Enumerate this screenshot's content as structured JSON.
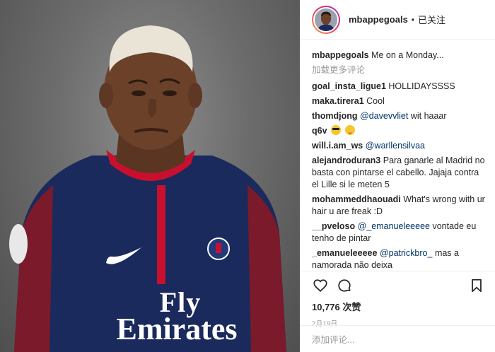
{
  "header": {
    "username": "mbappegoals",
    "separator": "•",
    "follow_status": "已关注"
  },
  "caption": {
    "username": "mbappegoals",
    "text": "Me on a Monday..."
  },
  "load_more_label": "加载更多评论",
  "comments": [
    {
      "user": "goal_insta_ligue1",
      "mention": "",
      "text": "HOLLIDAYSSSS"
    },
    {
      "user": "maka.tirera1",
      "mention": "",
      "text": "Cool"
    },
    {
      "user": "thomdjong",
      "mention": "@davevvliet",
      "text": "wit haaar"
    },
    {
      "user": "q6v",
      "mention": "",
      "text": ""
    },
    {
      "user": "will.i.am_ws",
      "mention": "@warllensilvaa",
      "text": ""
    },
    {
      "user": "alejandroduran3",
      "mention": "",
      "text": "Para ganarle al Madrid no basta con pintarse el cabello. Jajaja contra el Lille si le meten 5"
    },
    {
      "user": "mohammeddhaouadi",
      "mention": "",
      "text": "What's wrong with ur hair u are freak :D"
    },
    {
      "user": "__pveloso",
      "mention": "@_emanueleeeee",
      "text": "vontade eu tenho de pintar"
    },
    {
      "user": "_emanueleeeee",
      "mention": "@patrickbro_",
      "text": "mas a namorada não deixa"
    }
  ],
  "emojis": [
    "smiling-face-with-sunglasses",
    "smiling-face-with-smiling-eyes"
  ],
  "actions": {
    "likes": "10,776 次赞",
    "date": "2月19日",
    "add_comment_placeholder": "添加评论..."
  },
  "photo": {
    "sponsor_line1": "Fly",
    "sponsor_line2": "Emirates"
  },
  "colors": {
    "mention": "#003569",
    "muted": "#999999",
    "jersey": "#1b2a5c",
    "jersey_red": "#c8102e"
  }
}
